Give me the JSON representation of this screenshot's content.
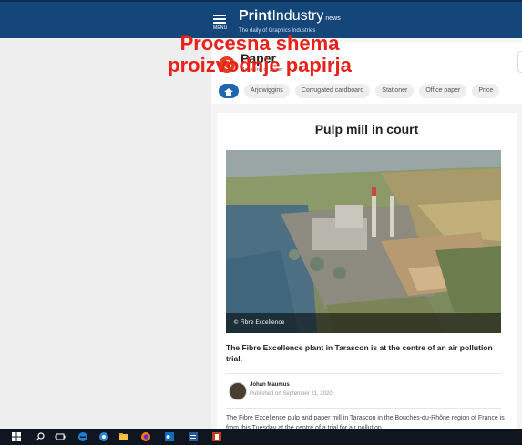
{
  "site": {
    "brand_bold": "Print",
    "brand_light": "Industry",
    "brand_suffix": "news",
    "tagline": "The daily of Graphics Industries",
    "menu_label": "MENU"
  },
  "magazine": {
    "title": "Paper",
    "subtitle": "Magazine of paper"
  },
  "overlay": {
    "line1": "Procesna shema",
    "line2": "proizvodnje papirja"
  },
  "chips": [
    "Arjowiggins",
    "Corrugated cardboard",
    "Stationer",
    "Office paper",
    "Price"
  ],
  "article": {
    "title": "Pulp mill in court",
    "photo_credit": "© Fibre Excellence",
    "lede": "The Fibre Excellence plant in Tarascon is at the centre of an air pollution trial.",
    "author": "Johan Maumus",
    "published": "Published on September 21, 2020",
    "body": "The Fibre Excellence pulp and paper mill in Tarascon in the Bouches-du-Rhône region of France is from this Tuesday at the centre of a trial for air pollution."
  },
  "taskbar": {
    "icons": [
      "windows-start-icon",
      "search-icon",
      "task-view-icon",
      "edge-icon",
      "pinned-app-icon",
      "file-explorer-icon",
      "firefox-icon",
      "outlook-icon",
      "word-icon",
      "powerpoint-icon"
    ]
  },
  "colors": {
    "header_bg": "#14467a",
    "accent_red": "#e8221a",
    "chip_home": "#1f66b1"
  }
}
